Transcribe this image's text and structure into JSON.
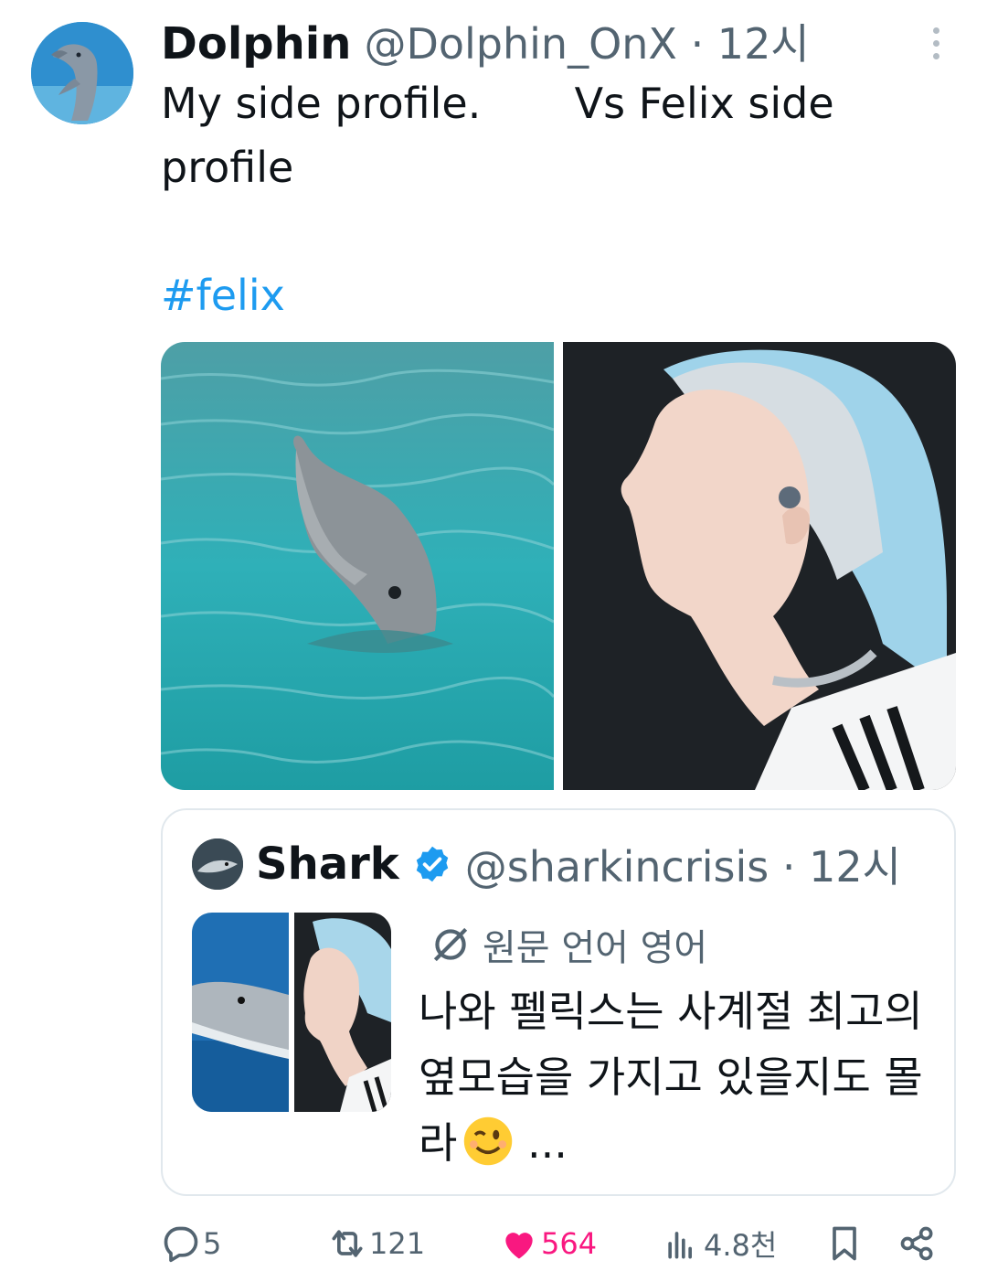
{
  "tweet": {
    "author_name": "Dolphin",
    "author_handle": "@Dolphin_OnX · 12시",
    "text": "My side profile.       Vs Felix side profile",
    "hashtag": "#felix",
    "avatar_icon": "dolphin-avatar-icon",
    "more_icon": "more-options-icon"
  },
  "quote": {
    "author_name": "Shark",
    "author_handle": "@sharkincrisis · 12시",
    "translate_label": "원문 언어 영어",
    "text": "나와 펠릭스는 사계절 최고의 옆모습을 가지고 있을지도 몰라",
    "ellipsis": "...",
    "emoji": "winking-face-emoji",
    "verified": true
  },
  "actions": {
    "replies": "5",
    "reposts": "121",
    "likes": "564",
    "views": "4.8천"
  },
  "colors": {
    "accent": "#1d9bf0",
    "like": "#f91880",
    "secondary_text": "#536471"
  }
}
